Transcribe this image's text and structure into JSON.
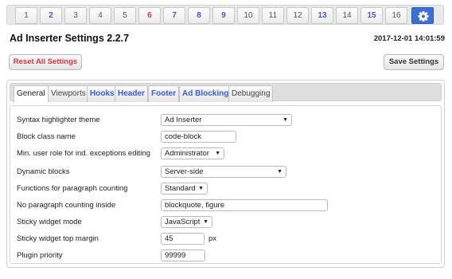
{
  "top_tabs": [
    {
      "label": "1",
      "color": "gray"
    },
    {
      "label": "2",
      "color": "blue"
    },
    {
      "label": "3",
      "color": "gray"
    },
    {
      "label": "4",
      "color": "gray"
    },
    {
      "label": "5",
      "color": "gray"
    },
    {
      "label": "6",
      "color": "red"
    },
    {
      "label": "7",
      "color": "blue"
    },
    {
      "label": "8",
      "color": "blue"
    },
    {
      "label": "9",
      "color": "blue"
    },
    {
      "label": "10",
      "color": "gray"
    },
    {
      "label": "11",
      "color": "gray"
    },
    {
      "label": "12",
      "color": "gray"
    },
    {
      "label": "13",
      "color": "blue"
    },
    {
      "label": "14",
      "color": "gray"
    },
    {
      "label": "15",
      "color": "blue"
    },
    {
      "label": "16",
      "color": "gray"
    }
  ],
  "settings_tab_icon": "gear-icon",
  "header": {
    "title": "Ad Inserter Settings 2.2.7",
    "timestamp": "2017-12-01 14:01:59"
  },
  "buttons": {
    "reset_all": "Reset All Settings",
    "save": "Save Settings"
  },
  "sub_tabs": [
    {
      "label": "General",
      "active": true
    },
    {
      "label": "Viewports",
      "active": false
    },
    {
      "label": "Hooks",
      "active": false,
      "highlight": true
    },
    {
      "label": "Header",
      "active": false,
      "highlight": true
    },
    {
      "label": "Footer",
      "active": false,
      "highlight": true
    },
    {
      "label": "Ad Blocking",
      "active": false,
      "highlight": true
    },
    {
      "label": "Debugging",
      "active": false
    }
  ],
  "settings": {
    "syntax_highlighter_theme": {
      "label": "Syntax highlighter theme",
      "value": "Ad Inserter"
    },
    "block_class_name": {
      "label": "Block class name",
      "value": "code-block"
    },
    "min_user_role": {
      "label": "Min. user role for ind. exceptions editing",
      "value": "Administrator"
    },
    "dynamic_blocks": {
      "label": "Dynamic blocks",
      "value": "Server-side"
    },
    "functions_paragraph_counting": {
      "label": "Functions for paragraph counting",
      "value": "Standard"
    },
    "no_paragraph_counting_inside": {
      "label": "No paragraph counting inside",
      "value": "blockquote, figure"
    },
    "sticky_widget_mode": {
      "label": "Sticky widget mode",
      "value": "JavaScript"
    },
    "sticky_widget_top_margin": {
      "label": "Sticky widget top margin",
      "value": "45",
      "unit": "px"
    },
    "plugin_priority": {
      "label": "Plugin priority",
      "value": "99999"
    }
  },
  "colors": {
    "accent_blue": "#3b6fd4",
    "link_blue": "#3b5bdb",
    "warning_red": "#d9363e"
  }
}
